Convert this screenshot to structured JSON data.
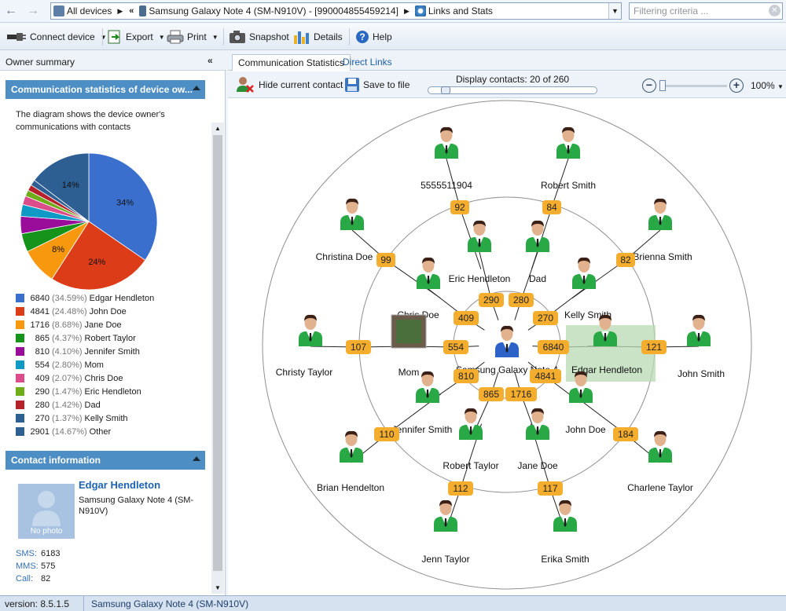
{
  "nav": {
    "back_glyph": "←",
    "forward_glyph": "→"
  },
  "breadcrumb": {
    "segments": [
      {
        "label": "All devices",
        "icon": "devices-icon"
      },
      {
        "label": "Samsung Galaxy Note 4 (SM-N910V)  -  [990004855459214]",
        "icon": "phone-icon"
      },
      {
        "label": "Links and Stats",
        "icon": "links-icon"
      }
    ],
    "collapse_glyph": "«"
  },
  "filter": {
    "placeholder": "Filtering criteria ..."
  },
  "toolbar": {
    "connect": "Connect device",
    "export": "Export",
    "print": "Print",
    "snapshot": "Snapshot",
    "details": "Details",
    "help": "Help"
  },
  "left": {
    "header": "Owner summary",
    "collapse_glyph": "«",
    "stats_title": "Communication statistics of device ow...",
    "description": "The diagram shows the device owner's communications with contacts",
    "contact_title": "Contact information"
  },
  "chart_data": {
    "type": "pie",
    "slices": [
      {
        "label": "Edgar Hendleton",
        "value": 6840,
        "percent": "34.59%",
        "color": "#3b6fce",
        "slice_label": "34%"
      },
      {
        "label": "John Doe",
        "value": 4841,
        "percent": "24.48%",
        "color": "#dc3c17",
        "slice_label": "24%"
      },
      {
        "label": "Jane Doe",
        "value": 1716,
        "percent": "8.68%",
        "color": "#f7980f",
        "slice_label": "8%"
      },
      {
        "label": "Robert Taylor",
        "value": 865,
        "percent": "4.37%",
        "color": "#16931a",
        "slice_label": ""
      },
      {
        "label": "Jennifer Smith",
        "value": 810,
        "percent": "4.10%",
        "color": "#9a0c9a",
        "slice_label": ""
      },
      {
        "label": "Mom",
        "value": 554,
        "percent": "2.80%",
        "color": "#0f9ac6",
        "slice_label": ""
      },
      {
        "label": "Chris Doe",
        "value": 409,
        "percent": "2.07%",
        "color": "#dc4c8a",
        "slice_label": ""
      },
      {
        "label": "Eric Hendleton",
        "value": 290,
        "percent": "1.47%",
        "color": "#6fad1b",
        "slice_label": ""
      },
      {
        "label": "Dad",
        "value": 280,
        "percent": "1.42%",
        "color": "#b5222b",
        "slice_label": ""
      },
      {
        "label": "Kelly Smith",
        "value": 270,
        "percent": "1.37%",
        "color": "#2d5f93",
        "slice_label": ""
      },
      {
        "label": "Other",
        "value": 2901,
        "percent": "14.67%",
        "color": "#2d5f93",
        "slice_label": "14%"
      }
    ]
  },
  "contact": {
    "name": "Edgar Hendleton",
    "device": "Samsung Galaxy Note 4 (SM-N910V)",
    "no_photo": "No photo",
    "stats": [
      {
        "key": "SMS:",
        "value": "6183"
      },
      {
        "key": "MMS:",
        "value": "575"
      },
      {
        "key": "Call:",
        "value": "82"
      }
    ]
  },
  "tabs": [
    {
      "label": "Communication Statistics",
      "active": true
    },
    {
      "label": "Direct Links",
      "active": false
    }
  ],
  "graph_toolbar": {
    "hide_contact": "Hide current contact",
    "save": "Save to file",
    "display": "Display contacts: 20 of 260",
    "zoom": "100%",
    "zoom_level": 0.0,
    "display_fraction": 0.077
  },
  "graph": {
    "center_label": "Samsung Galaxy Note 4",
    "contacts": [
      {
        "name": "5555511904",
        "count": "92"
      },
      {
        "name": "Robert Smith",
        "count": "84"
      },
      {
        "name": "Christina Doe",
        "count": "99"
      },
      {
        "name": "Brienna Smith",
        "count": "82"
      },
      {
        "name": "Eric Hendleton",
        "count": "290"
      },
      {
        "name": "Dad",
        "count": "280"
      },
      {
        "name": "Chris Doe",
        "count": "409"
      },
      {
        "name": "Kelly Smith",
        "count": "270"
      },
      {
        "name": "Mom",
        "count": "554"
      },
      {
        "name": "Edgar Hendleton",
        "count": "6840"
      },
      {
        "name": "Christy Taylor",
        "count": "107"
      },
      {
        "name": "John Smith",
        "count": "121"
      },
      {
        "name": "Jennifer Smith",
        "count": "810"
      },
      {
        "name": "John Doe",
        "count": "4841"
      },
      {
        "name": "Robert Taylor",
        "count": "865"
      },
      {
        "name": "Jane Doe",
        "count": "1716"
      },
      {
        "name": "Brian Hendelton",
        "count": "110"
      },
      {
        "name": "Charlene Taylor",
        "count": "184"
      },
      {
        "name": "Jenn Taylor",
        "count": "112"
      },
      {
        "name": "Erika Smith",
        "count": "117"
      }
    ]
  },
  "status": {
    "version": "version: 8.5.1.5",
    "device": "Samsung Galaxy Note 4 (SM-N910V)"
  }
}
